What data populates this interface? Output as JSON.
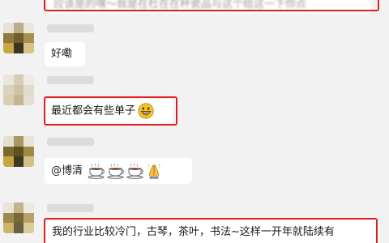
{
  "messages": [
    {
      "text": "应该是的嘿～我是在杜在在杯瓷品与这个给这一下你点"
    },
    {
      "text": "好嘞"
    },
    {
      "text": "最近都会有些单子"
    },
    {
      "text": "@博清"
    },
    {
      "text": "我的行业比较冷门，古琴，茶叶，书法~这样一开年就陆续有"
    }
  ],
  "icons": {
    "grin": "grinning-face-emoji",
    "cup": "hot-beverage-emoji",
    "pray": "folded-hands-emoji"
  },
  "colors": {
    "background": "#f2f2f2",
    "bubble": "#ffffff",
    "highlight": "#e02020"
  }
}
